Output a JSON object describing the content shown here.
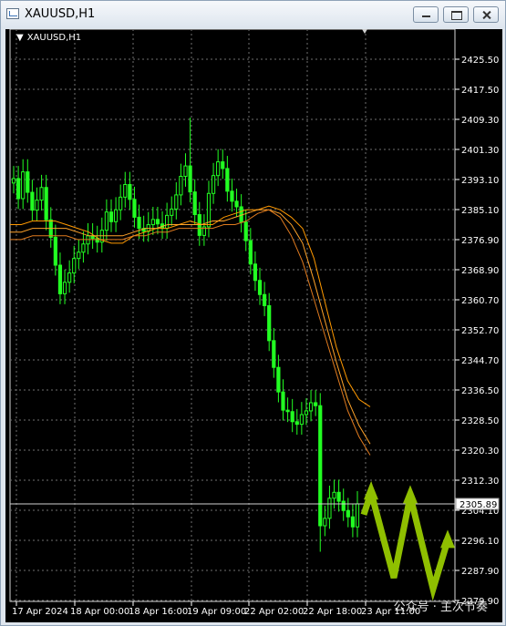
{
  "window": {
    "title": "XAUUSD,H1"
  },
  "chart_data": {
    "type": "candlestick",
    "symbol": "XAUUSD,H1",
    "current_price_label": "2305.89",
    "y_ticks": [
      "2425.50",
      "2417.50",
      "2409.30",
      "2401.30",
      "2393.10",
      "2385.10",
      "2376.90",
      "2368.90",
      "2360.70",
      "2352.70",
      "2344.70",
      "2336.50",
      "2328.50",
      "2320.30",
      "2312.30",
      "2304.10",
      "2296.10",
      "2287.90",
      "2279.90"
    ],
    "x_ticks": [
      "17 Apr 2024",
      "18 Apr 00:00",
      "18 Apr 16:00",
      "19 Apr 09:00",
      "22 Apr 02:00",
      "22 Apr 18:00",
      "23 Apr 11:00"
    ],
    "ylim": [
      2279.9,
      2425.5
    ],
    "closes": [
      2393.4,
      2388.0,
      2395.2,
      2389.7,
      2384.9,
      2387.6,
      2391.0,
      2382.3,
      2377.6,
      2370.1,
      2362.4,
      2365.5,
      2368.0,
      2371.9,
      2373.6,
      2375.8,
      2378.0,
      2377.3,
      2376.3,
      2379.5,
      2384.4,
      2381.8,
      2385.0,
      2388.4,
      2391.8,
      2387.8,
      2383.0,
      2380.0,
      2379.2,
      2381.0,
      2382.4,
      2381.2,
      2380.0,
      2383.5,
      2385.2,
      2389.0,
      2394.0,
      2396.8,
      2389.8,
      2383.7,
      2378.1,
      2380.4,
      2389.4,
      2394.2,
      2397.9,
      2396.1,
      2390.0,
      2387.3,
      2385.8,
      2381.7,
      2376.7,
      2370.4,
      2366.0,
      2362.2,
      2359.2,
      2349.8,
      2342.6,
      2336.0,
      2331.1,
      2330.7,
      2328.0,
      2327.3,
      2329.9,
      2330.9,
      2333.1,
      2332.3,
      2300.0,
      2302.0,
      2307.4,
      2309.0,
      2306.6,
      2304.1,
      2302.4,
      2299.7,
      2305.9
    ],
    "series": [
      {
        "name": "",
        "values": [
          2381,
          2381,
          2382,
          2382,
          2382,
          2381,
          2380,
          2379,
          2377,
          2376,
          2376,
          2378,
          2379,
          2380,
          2380,
          2381,
          2382,
          2381,
          2381,
          2383,
          2384,
          2385,
          2385,
          2386,
          2385,
          2383,
          2380,
          2372,
          2360,
          2348,
          2339,
          2334,
          2332
        ]
      },
      {
        "name": "",
        "values": [
          2379,
          2379,
          2380,
          2380,
          2380,
          2380,
          2379,
          2378,
          2378,
          2378,
          2378,
          2379,
          2380,
          2380,
          2381,
          2381,
          2381,
          2381,
          2382,
          2382,
          2383,
          2384,
          2385,
          2385,
          2384,
          2381,
          2376,
          2366,
          2355,
          2344,
          2334,
          2327,
          2322
        ]
      },
      {
        "name": "",
        "values": [
          2377,
          2377,
          2378,
          2378,
          2378,
          2378,
          2377,
          2377,
          2377,
          2377,
          2377,
          2378,
          2378,
          2379,
          2379,
          2380,
          2380,
          2380,
          2380,
          2381,
          2381,
          2382,
          2384,
          2385,
          2383,
          2378,
          2371,
          2361,
          2351,
          2341,
          2331,
          2324,
          2319
        ]
      }
    ],
    "forecast_arrow": [
      2303,
      2309,
      2286,
      2308,
      2283,
      2296
    ],
    "grid": true
  },
  "watermark": "公众号 · 主次节奏"
}
